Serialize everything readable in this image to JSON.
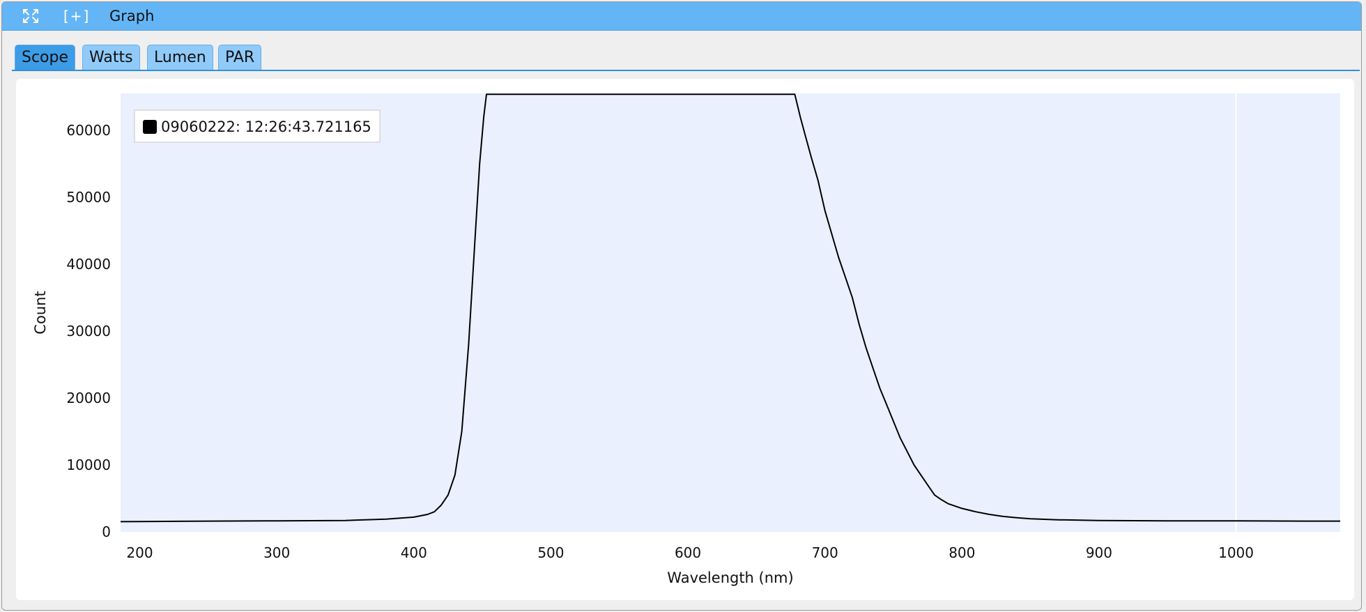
{
  "window": {
    "title": "Graph",
    "plus_label": "[+]",
    "titlebar_color": "#64b5f6",
    "icons": {
      "expand": "expand-arrows-icon"
    }
  },
  "tabs": [
    {
      "label": "Scope",
      "active": true
    },
    {
      "label": "Watts",
      "active": false
    },
    {
      "label": "Lumen",
      "active": false
    },
    {
      "label": "PAR",
      "active": false
    }
  ],
  "chart_data": {
    "type": "line",
    "xlabel": "Wavelength (nm)",
    "ylabel": "Count",
    "xlim": [
      186,
      1076
    ],
    "ylim": [
      0,
      65535
    ],
    "x_ticks": [
      200,
      300,
      400,
      500,
      600,
      700,
      800,
      900,
      1000
    ],
    "y_ticks": [
      0,
      10000,
      20000,
      30000,
      40000,
      50000,
      60000
    ],
    "grid": false,
    "plot_background": "#eaf0fd",
    "legend_position": "top-left",
    "series": [
      {
        "name": "09060222:  12:26:43.721165",
        "color": "#000000",
        "points": [
          [
            186,
            1520
          ],
          [
            200,
            1530
          ],
          [
            250,
            1600
          ],
          [
            300,
            1650
          ],
          [
            350,
            1700
          ],
          [
            380,
            1900
          ],
          [
            400,
            2200
          ],
          [
            410,
            2600
          ],
          [
            415,
            3000
          ],
          [
            420,
            4000
          ],
          [
            425,
            5500
          ],
          [
            430,
            8500
          ],
          [
            435,
            15000
          ],
          [
            440,
            28000
          ],
          [
            445,
            45000
          ],
          [
            448,
            55000
          ],
          [
            451,
            62000
          ],
          [
            453,
            65400
          ],
          [
            500,
            65400
          ],
          [
            600,
            65400
          ],
          [
            678,
            65400
          ],
          [
            682,
            62000
          ],
          [
            686,
            59000
          ],
          [
            690,
            56000
          ],
          [
            695,
            52500
          ],
          [
            700,
            48000
          ],
          [
            705,
            44500
          ],
          [
            710,
            41000
          ],
          [
            715,
            38000
          ],
          [
            720,
            35000
          ],
          [
            725,
            31000
          ],
          [
            730,
            27500
          ],
          [
            735,
            24500
          ],
          [
            740,
            21500
          ],
          [
            745,
            19000
          ],
          [
            750,
            16500
          ],
          [
            755,
            14000
          ],
          [
            760,
            12000
          ],
          [
            765,
            10000
          ],
          [
            770,
            8500
          ],
          [
            775,
            7000
          ],
          [
            780,
            5500
          ],
          [
            785,
            4800
          ],
          [
            790,
            4200
          ],
          [
            800,
            3500
          ],
          [
            810,
            3000
          ],
          [
            820,
            2600
          ],
          [
            830,
            2300
          ],
          [
            840,
            2100
          ],
          [
            850,
            1950
          ],
          [
            870,
            1800
          ],
          [
            900,
            1700
          ],
          [
            950,
            1650
          ],
          [
            1000,
            1650
          ],
          [
            1050,
            1600
          ],
          [
            1076,
            1600
          ]
        ]
      }
    ]
  }
}
